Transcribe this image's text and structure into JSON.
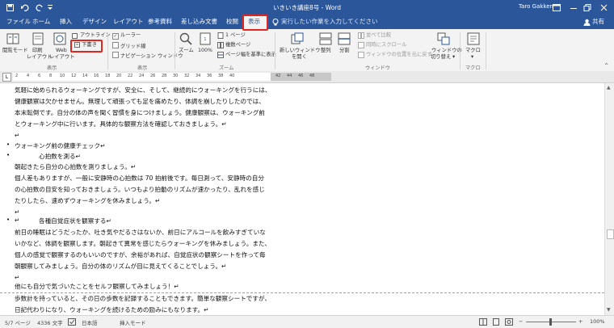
{
  "title": "いきいき講座8号 - Word",
  "qat": {
    "save_icon": "save-icon",
    "undo_icon": "undo-icon",
    "redo_icon": "redo-icon",
    "customize_icon": "customize-icon"
  },
  "window": {
    "user": "Taro Gakken",
    "ribbon_display_icon": "ribbon-display-icon",
    "minimize_icon": "minimize-icon",
    "restore_icon": "restore-icon",
    "close_icon": "close-icon"
  },
  "tabs": [
    "ファイル",
    "ホーム",
    "挿入",
    "デザイン",
    "レイアウト",
    "参考資料",
    "差し込み文書",
    "校閲",
    "表示"
  ],
  "active_tab": "表示",
  "tell_me": "実行したい作業を入力してください",
  "share": "共有",
  "ribbon": {
    "views": {
      "read_mode": "閲覧モード",
      "print_layout_1": "印刷",
      "print_layout_2": "レイアウト",
      "web_layout_1": "Web",
      "web_layout_2": "レイアウト",
      "outline": "アウトライン",
      "draft": "下書き",
      "group": "表示"
    },
    "show": {
      "ruler": "ルーラー",
      "gridlines": "グリッド線",
      "nav_pane": "ナビゲーション ウィンドウ",
      "ruler_checked": true,
      "gridlines_checked": false,
      "nav_checked": false,
      "group": "表示"
    },
    "zoom": {
      "zoom": "ズーム",
      "hundred": "100%",
      "one_page": "1 ページ",
      "multi_page": "複数ページ",
      "page_width": "ページ幅を基準に表示",
      "group": "ズーム"
    },
    "window": {
      "new_window_1": "新しいウィンドウ",
      "new_window_2": "を開く",
      "arrange": "整列",
      "split": "分割",
      "side_by_side": "並べて比較",
      "sync_scroll": "同時にスクロール",
      "reset_pos": "ウィンドウの位置を元に戻す",
      "switch_1": "ウィンドウの",
      "switch_2": "切り替え",
      "group": "ウィンドウ"
    },
    "macro": {
      "label": "マクロ",
      "group": "マクロ"
    }
  },
  "ruler": {
    "ticks": [
      "2",
      "4",
      "6",
      "8",
      "10",
      "12",
      "14",
      "16",
      "18",
      "20",
      "22",
      "24",
      "26",
      "28",
      "30",
      "32",
      "34",
      "36",
      "38",
      "40",
      "42",
      "44",
      "46",
      "48"
    ]
  },
  "document": {
    "lines": [
      "気軽に始められるウォーキングですが、安全に、そして、継続的にウォーキングを行うには、",
      "健康観察は欠かせません。無理して頑張っても足を痛めたり、体調を崩したりしたのでは、",
      "本末転倒です。自分の体の声を聞く習慣を身につけましょう。健康観察は、ウォーキング前",
      "とウォーキング中に行います。具体的な観察方法を確認しておきましょう。↵",
      "↵",
      "ウォーキング前の健康チェック↵",
      "心拍数を測る↵",
      "朝起きたら自分の心拍数を測りましょう。↵",
      "個人差もありますが、一般に安静時の心拍数は 70 拍前後です。毎日測って、安静時の自分",
      "の心拍数の目安を知っておきましょう。いつもより拍動のリズムが速かったり、乱れを感じ",
      "たりしたら、速めずウォーキングを休みましょう。↵",
      "↵",
      "↵",
      "各種自覚症状を観察する↵",
      "前日の睡眠はどうだったか、吐き気やだるさはないか、前日にアルコールを飲みすぎていな",
      "いかなど、体調を観察します。朝起きて異常を感じたらウォーキングを休みましょう。また、",
      "個人の感覚で観察するのもいいのですが、余裕があれば、自覚症状の観察シートを作って毎",
      "朝観察してみましょう。自分の体のリズムが目に見えてくることでしょう。↵",
      "↵",
      "他にも自分で気づいたことをセルフ観察してみましょう！↵",
      "歩数計を持っていると、その日の歩数を記録することもできます。簡単な観察シートですが、",
      "日記代わりになり、ウォーキングを続けるための励みにもなります。↵"
    ]
  },
  "status": {
    "page": "5/7 ページ",
    "words": "4336 文字",
    "proof_icon": "proofing-icon",
    "lang": "日本語",
    "mode": "挿入モード",
    "zoom": "100%"
  }
}
